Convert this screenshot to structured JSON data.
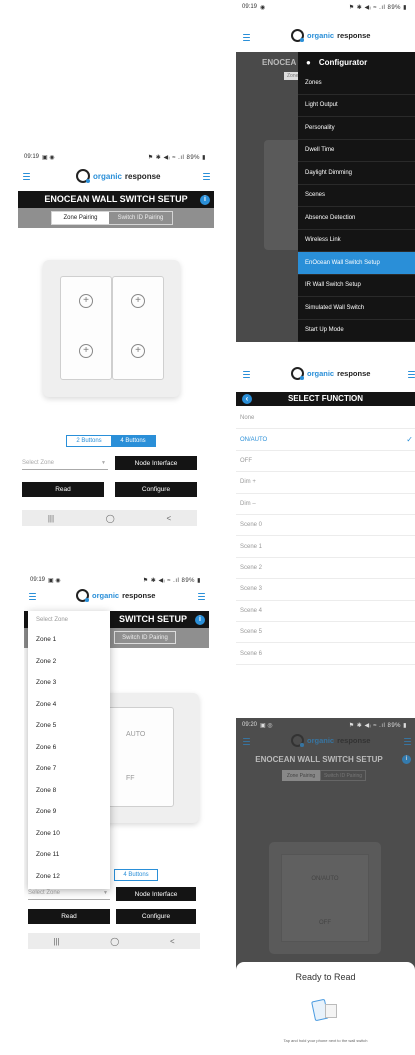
{
  "brand": {
    "organic": "organic",
    "response": "response"
  },
  "panel1": {
    "status_time": "09:19",
    "status_left_icons": "▣ ◉",
    "status_right": "⚑ ✱ ◀ᵢ ≈ .ıl 89% ▮",
    "title": "ENOCEAN WALL SWITCH SETUP",
    "info": "i",
    "tab_zone": "Zone Pairing",
    "tab_switch": "Switch ID Pairing",
    "btn_2": "2 Buttons",
    "btn_4": "4 Buttons",
    "zone_placeholder": "Select Zone",
    "node_interface": "Node Interface",
    "read": "Read",
    "configure": "Configure",
    "nav_recent": "|||",
    "nav_home": "◯",
    "nav_back": "<"
  },
  "panel2": {
    "status_time": "09:19",
    "status_left_icons": "◉",
    "status_right": "⚑ ✱ ◀ᵢ ≈ .ıl 89% ▮",
    "title_partial": "ENOCEA",
    "tab_partial": "Zone",
    "menu_title": "Configurator",
    "menu_items": [
      "Zones",
      "Light Output",
      "Personality",
      "Dwell Time",
      "Daylight Dimming",
      "Scenes",
      "Absence Detection",
      "Wireless Link",
      "EnOcean Wall Switch Setup",
      "IR Wall Switch Setup",
      "Simulated Wall Switch",
      "Start Up Mode"
    ],
    "active_index": 8
  },
  "panel3": {
    "status_time": "09:19",
    "status_left_icons": "▣ ◉",
    "status_right": "⚑ ✱ ◀ᵢ ≈ .ıl 89% ▮",
    "title_partial": "SWITCH SETUP",
    "info": "i",
    "tab_switch": "Switch ID Pairing",
    "rocker_top": "AUTO",
    "rocker_bottom": "FF",
    "dropdown_header": "Select Zone",
    "zones": [
      "Zone 1",
      "Zone 2",
      "Zone 3",
      "Zone 4",
      "Zone 5",
      "Zone 6",
      "Zone 7",
      "Zone 8",
      "Zone 9",
      "Zone 10",
      "Zone 11",
      "Zone 12"
    ],
    "btn_4": "4 Buttons",
    "zone_placeholder": "Select Zone",
    "node_interface": "Node Interface",
    "read": "Read",
    "configure": "Configure",
    "nav_recent": "|||",
    "nav_home": "◯",
    "nav_back": "<"
  },
  "panel4": {
    "back": "‹",
    "title": "SELECT FUNCTION",
    "functions": [
      "None",
      "ON/AUTO",
      "OFF",
      "Dim +",
      "Dim –",
      "Scene 0",
      "Scene 1",
      "Scene 2",
      "Scene 3",
      "Scene 4",
      "Scene 5",
      "Scene 6"
    ],
    "selected_index": 1,
    "check": "✓"
  },
  "panel5": {
    "status_time": "09:20",
    "status_left_icons": "▣ ◎",
    "status_right": "⚑ ✱ ◀ᵢ ≈ .ıl 89% ▮",
    "title": "ENOCEAN WALL SWITCH SETUP",
    "info": "i",
    "tab_zone": "Zone Pairing",
    "tab_switch": "Switch ID Pairing",
    "rocker_top": "ON/AUTO",
    "rocker_bottom": "OFF",
    "sheet_title": "Ready to Read",
    "sheet_hint": "Tap and hold your phone next to the wall switch"
  },
  "colors": {
    "accent": "#2a8fd8",
    "dark": "#141414",
    "grey": "#8f8f8f"
  }
}
